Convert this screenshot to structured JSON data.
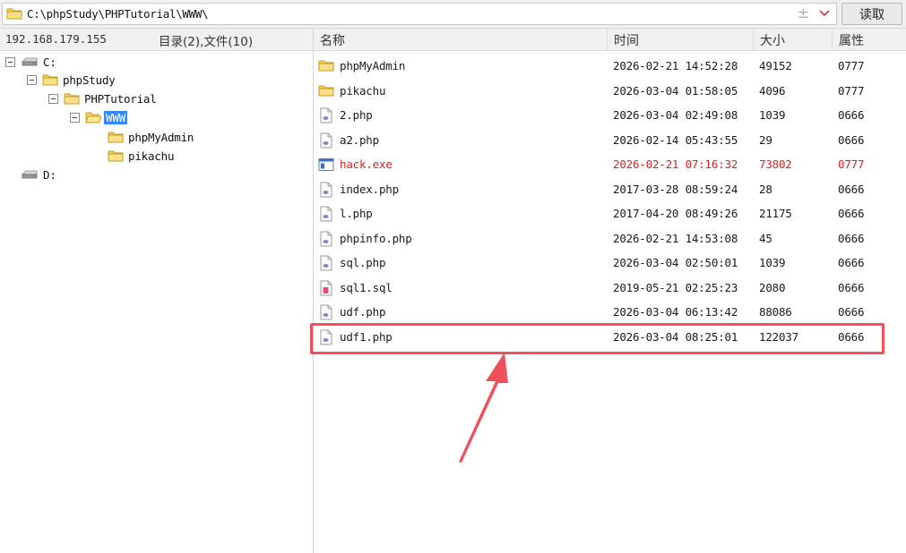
{
  "pathbar": {
    "path": "C:\\phpStudy\\PHPTutorial\\WWW\\",
    "plus_glyph": "±",
    "read_button": "读取"
  },
  "left_info": {
    "ip": "192.168.179.155",
    "counts": "目录(2),文件(10)"
  },
  "tree": {
    "drive_c": "C:",
    "phpstudy": "phpStudy",
    "phptutorial": "PHPTutorial",
    "www": "WWW",
    "phpmyadmin": "phpMyAdmin",
    "pikachu": "pikachu",
    "drive_d": "D:"
  },
  "columns": {
    "name": "名称",
    "time": "时间",
    "size": "大小",
    "attr": "属性"
  },
  "files": [
    {
      "name": "phpMyAdmin",
      "time": "2026-02-21 14:52:28",
      "size": "49152",
      "attr": "0777",
      "icon": "folder"
    },
    {
      "name": "pikachu",
      "time": "2026-03-04 01:58:05",
      "size": "4096",
      "attr": "0777",
      "icon": "folder"
    },
    {
      "name": "2.php",
      "time": "2026-03-04 02:49:08",
      "size": "1039",
      "attr": "0666",
      "icon": "php"
    },
    {
      "name": "a2.php",
      "time": "2026-02-14 05:43:55",
      "size": "29",
      "attr": "0666",
      "icon": "php"
    },
    {
      "name": "hack.exe",
      "time": "2026-02-21 07:16:32",
      "size": "73802",
      "attr": "0777",
      "icon": "exe",
      "highlight_color": "#e02020"
    },
    {
      "name": "index.php",
      "time": "2017-03-28 08:59:24",
      "size": "28",
      "attr": "0666",
      "icon": "php"
    },
    {
      "name": "l.php",
      "time": "2017-04-20 08:49:26",
      "size": "21175",
      "attr": "0666",
      "icon": "php"
    },
    {
      "name": "phpinfo.php",
      "time": "2026-02-21 14:53:08",
      "size": "45",
      "attr": "0666",
      "icon": "php"
    },
    {
      "name": "sql.php",
      "time": "2026-03-04 02:50:01",
      "size": "1039",
      "attr": "0666",
      "icon": "php"
    },
    {
      "name": "sql1.sql",
      "time": "2019-05-21 02:25:23",
      "size": "2080",
      "attr": "0666",
      "icon": "sql"
    },
    {
      "name": "udf.php",
      "time": "2026-03-04 06:13:42",
      "size": "88086",
      "attr": "0666",
      "icon": "php"
    },
    {
      "name": "udf1.php",
      "time": "2026-03-04 08:25:01",
      "size": "122037",
      "attr": "0666",
      "icon": "php"
    }
  ],
  "annotation": {
    "box_color": "#f0505a",
    "arrow_color": "#f0505a"
  }
}
